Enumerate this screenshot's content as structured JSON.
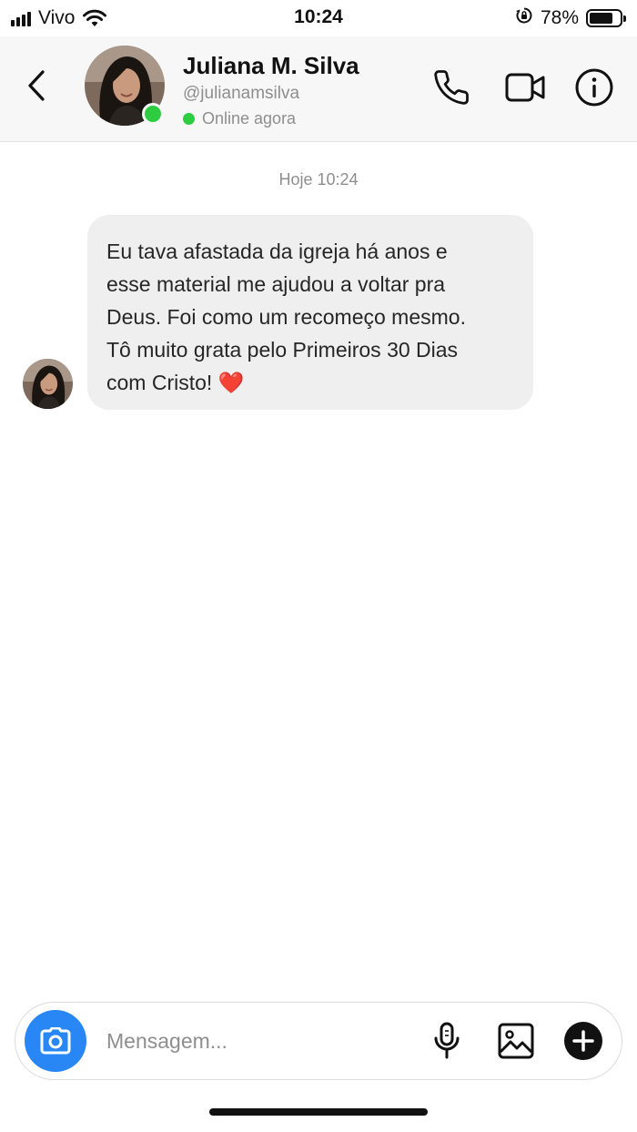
{
  "status_bar": {
    "carrier": "Vivo",
    "time": "10:24",
    "battery_percent": "78%",
    "battery_level": 0.78,
    "icons": [
      "signal-icon",
      "wifi-icon",
      "orientation-lock-icon",
      "battery-icon"
    ]
  },
  "header": {
    "back_icon": "chevron-left-icon",
    "name": "Juliana M. Silva",
    "handle": "@julianamsilva",
    "status": "Online agora",
    "online_color": "#2ecc40",
    "actions": [
      "phone-icon",
      "video-camera-icon",
      "info-icon"
    ]
  },
  "chat": {
    "timestamp": "Hoje 10:24",
    "messages": [
      {
        "lines": [
          "Eu tava afastada da igreja há anos e",
          "esse material me ajudou a voltar pra",
          "Deus. Foi como um recomeço mesmo.",
          "Tô muito grata pelo Primeiros 30 Dias",
          "com Cristo! ❤️"
        ],
        "bubble_color": "#efefef"
      }
    ]
  },
  "composer": {
    "placeholder": "Mensagem...",
    "camera_color": "#2986f5",
    "icons": [
      "camera-icon",
      "microphone-icon",
      "gallery-icon",
      "add-icon"
    ]
  }
}
